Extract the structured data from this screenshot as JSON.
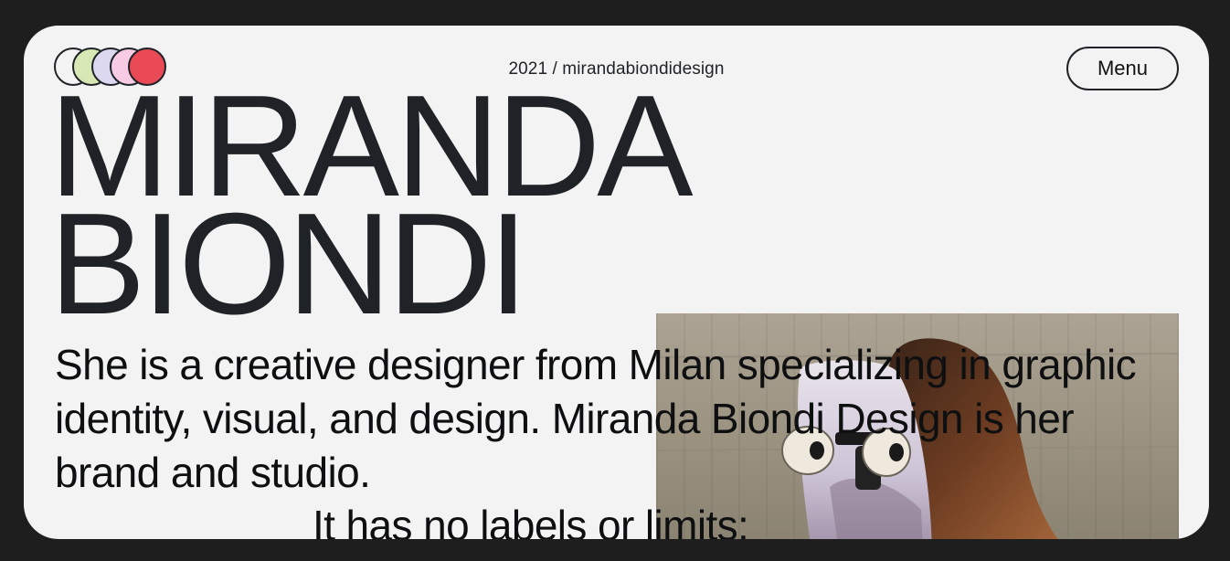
{
  "header": {
    "year_site": "2021 / mirandabiondidesign",
    "menu_label": "Menu",
    "logo_colors": [
      "#f3f3f3",
      "#d8e8b4",
      "#dcd8ef",
      "#f8cbe5",
      "#ea4a55"
    ]
  },
  "hero": {
    "name_line1": "MIRANDA",
    "name_line2": "BIONDI"
  },
  "intro": {
    "text": "She is a creative designer from Milan specializing in graphic identity, visual, and design. Miranda Biondi Design is her brand and studio.",
    "text2": "It has no labels or limits:"
  },
  "colors": {
    "page_bg": "#1e1e1f",
    "card_bg": "#f3f3f3",
    "ink": "#1f2226"
  }
}
